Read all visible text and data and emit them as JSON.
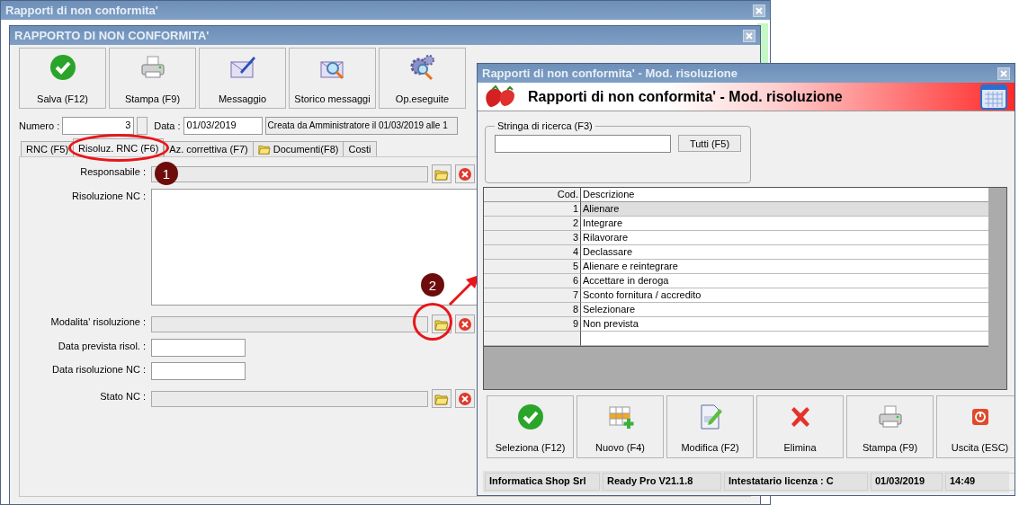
{
  "background_window": {
    "title": "Rapporti di non conformita'"
  },
  "main_window": {
    "title": "RAPPORTO DI NON CONFORMITA'",
    "toolbar": [
      {
        "label": "Salva (F12)"
      },
      {
        "label": "Stampa (F9)"
      },
      {
        "label": "Messaggio"
      },
      {
        "label": "Storico messaggi"
      },
      {
        "label": "Op.eseguite"
      }
    ],
    "numero": {
      "label": "Numero :",
      "value": "3"
    },
    "data": {
      "label": "Data :",
      "value": "01/03/2019"
    },
    "info": "Creata da Amministratore il 01/03/2019 alle 1",
    "tabs": [
      {
        "label": "RNC (F5)",
        "selected": false,
        "kind": "text"
      },
      {
        "label": "Risoluz. RNC (F6)",
        "selected": true,
        "kind": "text"
      },
      {
        "label": "Az. correttiva (F7)",
        "selected": false,
        "kind": "text"
      },
      {
        "label": "Documenti(F8)",
        "selected": false,
        "kind": "folder"
      },
      {
        "label": "Costi",
        "selected": false,
        "kind": "text"
      }
    ],
    "fields": [
      {
        "kind": "lookup",
        "label": "Responsabile :"
      },
      {
        "kind": "memo",
        "label": "Risoluzione NC :"
      },
      {
        "kind": "lookup",
        "label": "Modalita' risoluzione :"
      },
      {
        "kind": "date",
        "label": "Data prevista risol. :"
      },
      {
        "kind": "date",
        "label": "Data risoluzione NC :"
      },
      {
        "kind": "lookup",
        "label": "Stato NC :"
      }
    ]
  },
  "dialog": {
    "title": "Rapporti di non conformita' - Mod. risoluzione",
    "header": "Rapporti di non conformita' - Mod. risoluzione",
    "search": {
      "legend": "Stringa di ricerca (F3)",
      "button": "Tutti (F5)"
    },
    "table": {
      "columns": [
        "Cod.",
        "Descrizione"
      ],
      "rows": [
        {
          "cells": [
            "1",
            "Alienare"
          ],
          "selected": true
        },
        {
          "cells": [
            "2",
            "Integrare"
          ],
          "selected": false
        },
        {
          "cells": [
            "3",
            "Rilavorare"
          ],
          "selected": false
        },
        {
          "cells": [
            "4",
            "Declassare"
          ],
          "selected": false
        },
        {
          "cells": [
            "5",
            "Alienare e reintegrare"
          ],
          "selected": false
        },
        {
          "cells": [
            "6",
            "Accettare in deroga"
          ],
          "selected": false
        },
        {
          "cells": [
            "7",
            "Sconto fornitura / accredito"
          ],
          "selected": false
        },
        {
          "cells": [
            "8",
            "Selezionare"
          ],
          "selected": false
        },
        {
          "cells": [
            "9",
            "Non prevista"
          ],
          "selected": false
        }
      ]
    },
    "buttons": [
      {
        "label": "Seleziona (F12)"
      },
      {
        "label": "Nuovo (F4)"
      },
      {
        "label": "Modifica (F2)"
      },
      {
        "label": "Elimina"
      },
      {
        "label": "Stampa (F9)"
      },
      {
        "label": "Uscita (ESC)"
      }
    ],
    "status_bar": [
      "Informatica Shop Srl",
      "Ready Pro V21.1.8",
      "Intestatario licenza : C",
      "01/03/2019",
      "14:49"
    ]
  },
  "annotations": [
    {
      "number": "1"
    },
    {
      "number": "2"
    }
  ]
}
